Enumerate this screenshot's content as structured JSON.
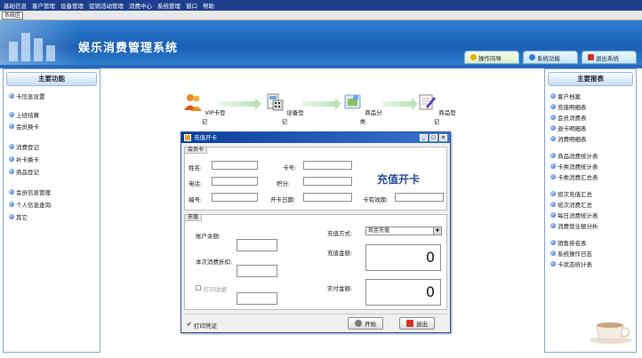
{
  "menu": [
    "基础信息",
    "客户管理",
    "设备管理",
    "促销活动管理",
    "消费中心",
    "系统管理",
    "窗口",
    "帮助"
  ],
  "toolstrip_label": "系统区",
  "app_title": "娱乐消费管理系统",
  "header_tabs": [
    {
      "label": "操作向导",
      "icon_color": "#e6b000"
    },
    {
      "label": "系统功能",
      "icon_color": "#2e7bd6"
    },
    {
      "label": "退出系统",
      "icon_color": "#d6302a"
    }
  ],
  "left_panel": {
    "title": "主要功能",
    "groups": [
      [
        "卡信息设置"
      ],
      [
        "上班结算",
        "会员换卡"
      ],
      [
        "消费登记",
        "补卡换卡",
        "商品登记"
      ],
      [
        "会员信息管理",
        "个人信息查询",
        "其它"
      ]
    ]
  },
  "right_panel": {
    "title": "主要报表",
    "groups": [
      [
        "客户档案",
        "充值明细表",
        "会员消费表",
        "退卡明细表",
        "消费明细表"
      ],
      [
        "商品消费统计表",
        "卡类消费统计表",
        "卡类消费汇总表"
      ],
      [
        "班次充值汇总",
        "班次消费汇总",
        "每日消费统计表",
        "消费营业额分析"
      ],
      [
        "销售排名表",
        "系统操作日志",
        "卡状态统计表"
      ]
    ]
  },
  "flow": [
    {
      "label": "VIP卡登记"
    },
    {
      "label": "设备登记"
    },
    {
      "label": "商品分类"
    },
    {
      "label": "商品登记"
    }
  ],
  "dialog": {
    "title": "充值开卡",
    "controls": [
      "_",
      "□",
      "×"
    ],
    "group1": {
      "header": "会员卡",
      "fields": {
        "name": "姓名:",
        "card_no": "卡号:",
        "phone": "电话:",
        "points": "积分:",
        "id": "编号:",
        "open_date": "开卡日期:",
        "card_status": "卡有效期:"
      },
      "big_title": "充值开卡"
    },
    "group2": {
      "header": "充值",
      "balance_label": "账户余额:",
      "discount_label": "本次消费折扣:",
      "print_label": "打印收据",
      "method_label": "充值方式:",
      "method_value": "现金充值",
      "amount_label": "充值金额:",
      "amount_value": "0",
      "actual_label": "实付金额:",
      "actual_value": "0"
    },
    "footer": {
      "checkbox_label": "打印凭证",
      "ok": "开始",
      "cancel": "退出"
    }
  }
}
